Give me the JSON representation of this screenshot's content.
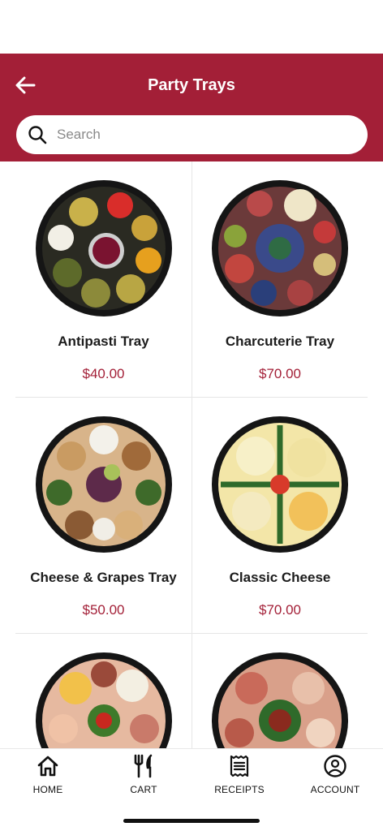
{
  "header": {
    "title": "Party Trays"
  },
  "search": {
    "placeholder": "Search"
  },
  "products": [
    {
      "name": "Antipasti Tray",
      "price": "$40.00"
    },
    {
      "name": "Charcuterie Tray",
      "price": "$70.00"
    },
    {
      "name": "Cheese & Grapes Tray",
      "price": "$50.00"
    },
    {
      "name": "Classic Cheese",
      "price": "$70.00"
    },
    {
      "name": "",
      "price": ""
    },
    {
      "name": "",
      "price": ""
    }
  ],
  "nav": {
    "home": "HOME",
    "cart": "CART",
    "receipts": "RECEIPTS",
    "account": "ACCOUNT"
  },
  "colors": {
    "brand": "#a31f37",
    "price": "#a31f37"
  },
  "icons": [
    "back-arrow-icon",
    "search-icon",
    "home-icon",
    "fork-knife-icon",
    "receipt-icon",
    "account-icon"
  ]
}
